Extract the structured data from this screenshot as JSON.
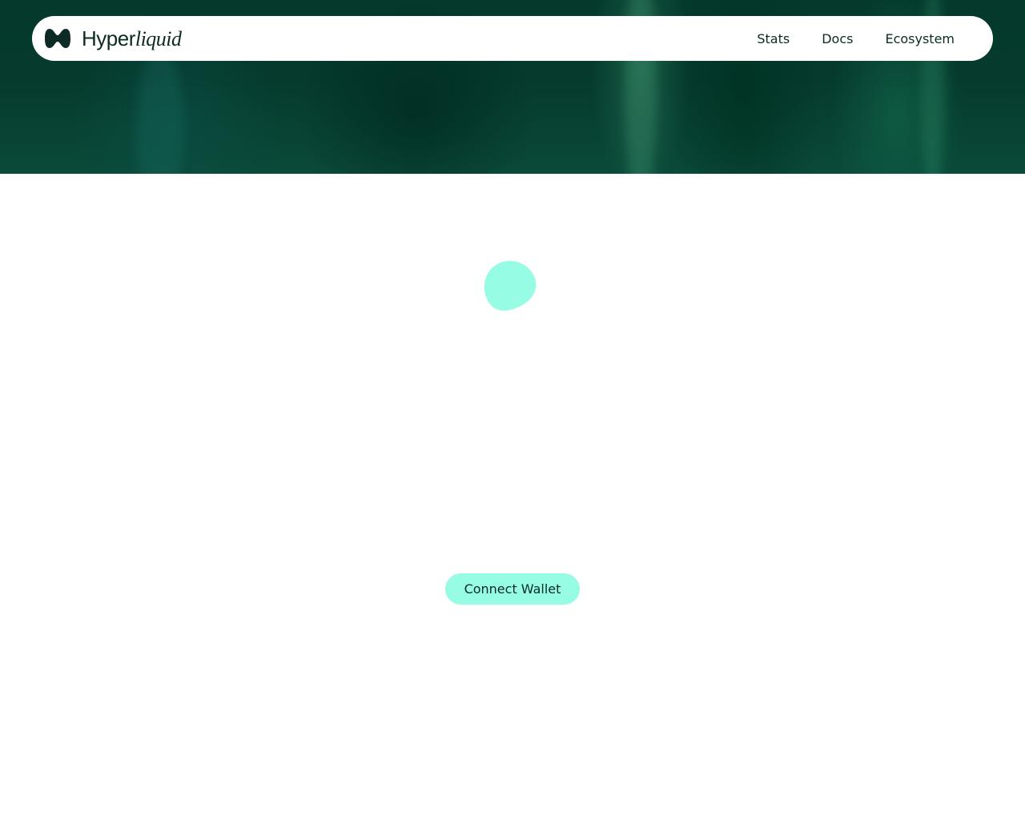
{
  "brand": {
    "name_part1": "Hyper",
    "name_part2": "liquid",
    "logo_icon": "hyperliquid-logo-icon",
    "color": "#0b2b24"
  },
  "nav": {
    "links": [
      {
        "label": "Stats"
      },
      {
        "label": "Docs"
      },
      {
        "label": "Ecosystem"
      }
    ]
  },
  "hero": {
    "background": "#053a2d"
  },
  "loader": {
    "icon": "loading-blob-icon",
    "color": "#97fce4"
  },
  "main": {
    "connect_label": "Connect Wallet",
    "accent": "#97fce4"
  }
}
